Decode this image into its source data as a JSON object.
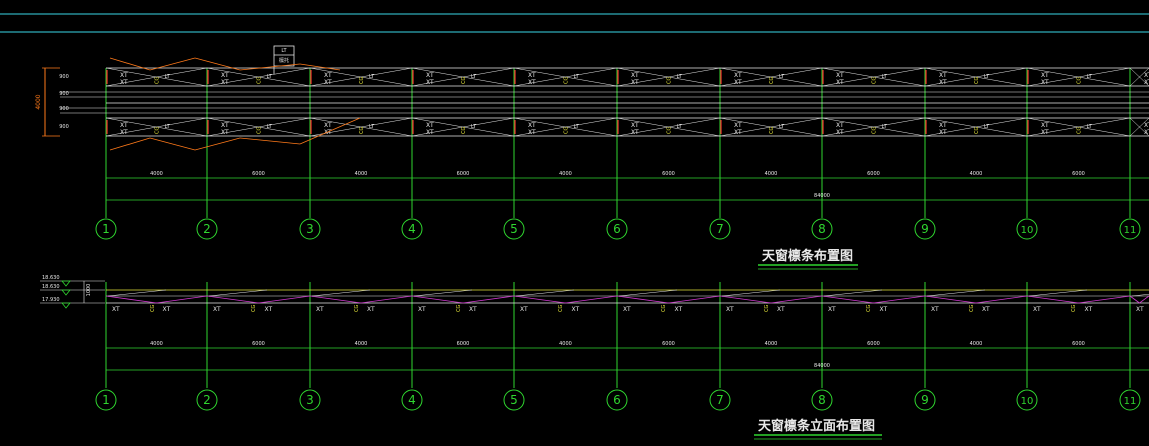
{
  "drawing": {
    "plan_title": "天窗檩条布置图",
    "elevation_title": "天窗檩条立面布置图",
    "axis_labels": [
      "1",
      "2",
      "3",
      "4",
      "5",
      "6",
      "7",
      "8",
      "9",
      "10",
      "11"
    ],
    "member_xt": "XT",
    "member_lt": "LT",
    "member_cg": "CG",
    "bay_dims": [
      "4000",
      "6000",
      "4000",
      "6000",
      "4000",
      "6000",
      "4000",
      "6000",
      "4000",
      "6000"
    ],
    "total_dim": "84000",
    "plan_side_dim": "4000",
    "plan_side_dims": [
      "900",
      "900",
      "900",
      "900"
    ],
    "elev_levels": [
      "18.630",
      "18.630",
      "17.930"
    ],
    "elev_side_dim": "1000",
    "callout_top": "LT",
    "callout_bottom": "檩托",
    "colors": {
      "cyan": "#3ad6e6",
      "grid_green": "#2fd62f",
      "white": "#e8e8e8",
      "yellow": "#e6e63a",
      "red": "#ff3030",
      "orange": "#ff7a1a",
      "magenta": "#d03ad0"
    }
  }
}
